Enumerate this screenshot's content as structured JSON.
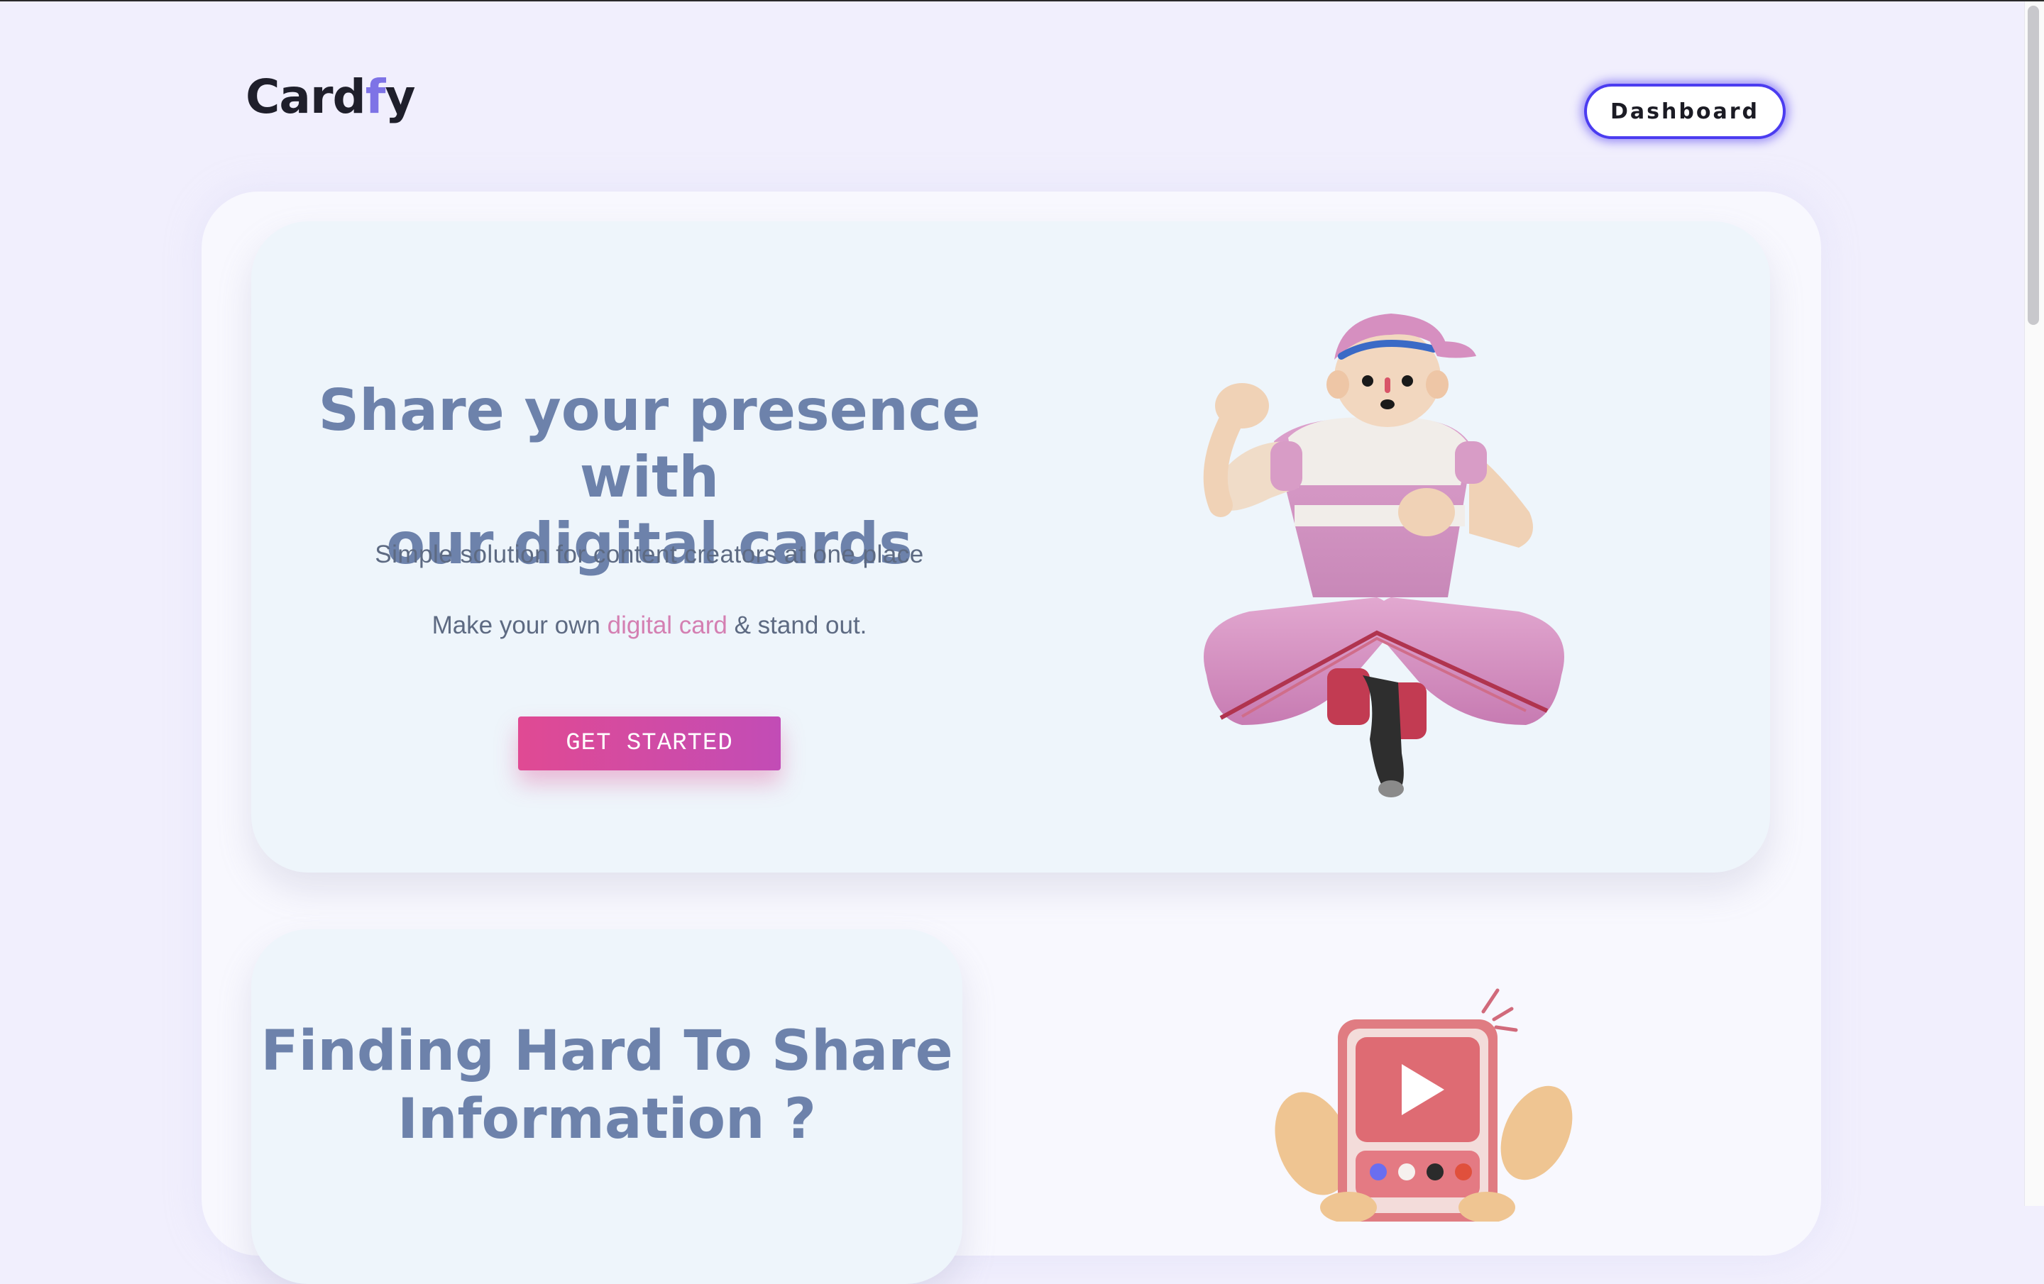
{
  "header": {
    "logo_main": "Card",
    "logo_accent": "f",
    "logo_tail": "y",
    "dashboard_label": "Dashboard"
  },
  "hero": {
    "title_line1": "Share your presence with",
    "title_line2": "our digital cards",
    "subtitle": "Simple solution for content creators at one place",
    "line_prefix": "Make your own ",
    "line_highlight": "digital card",
    "line_suffix": " & stand out.",
    "cta_label": "GET STARTED"
  },
  "problem": {
    "title_line1": "Finding Hard To Share",
    "title_line2": "Information ?"
  },
  "colors": {
    "background": "#f1effd",
    "card": "#eef5fb",
    "heading": "#6d82ab",
    "accent_pink": "#d47fb2",
    "cta_start": "#e04a93",
    "cta_end": "#c24cb6",
    "dashboard_border": "#4b3cf0",
    "logo_accent": "#7e73e6"
  },
  "icons": {
    "hero_illustration": "jumping-person-illustration",
    "problem_illustration": "hand-holding-phone-video-illustration"
  }
}
